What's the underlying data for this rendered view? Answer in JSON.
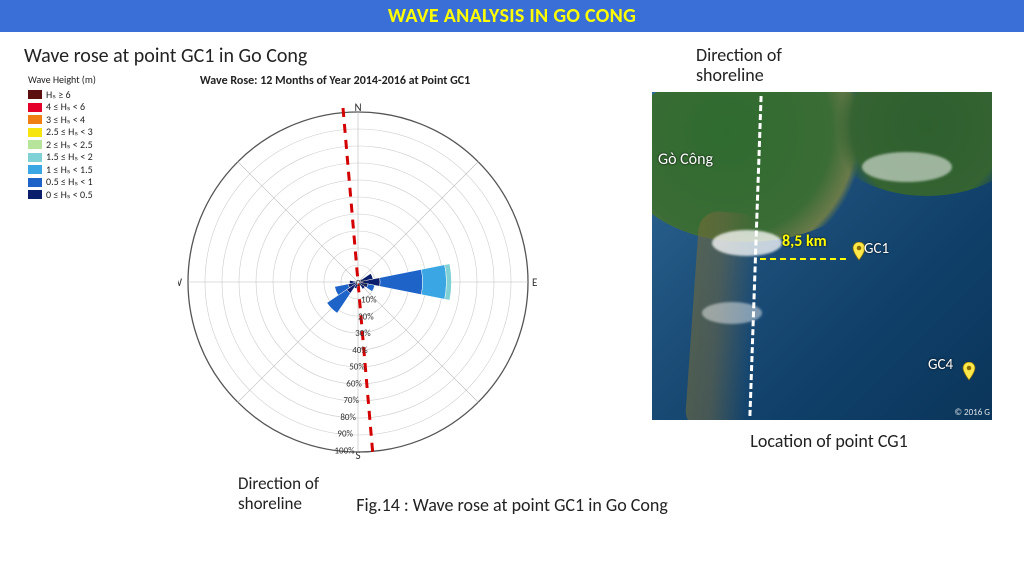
{
  "header": {
    "title": "WAVE ANALYSIS IN GO CONG"
  },
  "left": {
    "caption": "Wave rose at point GC1 in Go Cong",
    "chart_title": "Wave Rose: 12 Months of Year 2014-2016 at Point GC1",
    "legend_title": "Wave Height (m)",
    "legend": [
      {
        "label": "Hₛ ≥ 6",
        "color": "#5b0f0f"
      },
      {
        "label": "4 ≤ Hₛ < 6",
        "color": "#e4002b"
      },
      {
        "label": "3 ≤ Hₛ < 4",
        "color": "#f07f13"
      },
      {
        "label": "2.5 ≤ Hₛ < 3",
        "color": "#f6e50e"
      },
      {
        "label": "2 ≤ Hₛ < 2.5",
        "color": "#b7e49b"
      },
      {
        "label": "1.5 ≤ Hₛ < 2",
        "color": "#7fd1d6"
      },
      {
        "label": "1 ≤ Hₛ < 1.5",
        "color": "#3aa7e4"
      },
      {
        "label": "0.5 ≤ Hₛ < 1",
        "color": "#1e63c8"
      },
      {
        "label": "0 ≤ Hₛ < 0.5",
        "color": "#0a1e6b"
      }
    ],
    "compass": {
      "N": "N",
      "E": "E",
      "S": "S",
      "W": "W"
    },
    "rings_pct": [
      "0%",
      "10%",
      "20%",
      "30%",
      "40%",
      "50%",
      "60%",
      "70%",
      "80%",
      "90%",
      "100%"
    ],
    "shoreline_label": "Direction of shoreline"
  },
  "right": {
    "direction_label": "Direction of shoreline",
    "place_label": "Gò Công",
    "distance_label": "8,5 km",
    "points": {
      "gc1": "GC1",
      "gc4": "GC4"
    },
    "copyright": "© 2016 G",
    "map_caption": "Location of point CG1"
  },
  "figure_caption": "Fig.14 : Wave rose at point GC1 in Go Cong",
  "chart_data": {
    "type": "wave_rose",
    "title": "Wave Rose: 12 Months of Year 2014-2016 at Point GC1",
    "radial_unit": "percent_frequency",
    "radial_ticks_pct": [
      0,
      10,
      20,
      30,
      40,
      50,
      60,
      70,
      80,
      90,
      100
    ],
    "direction_bins_deg": 22.5,
    "height_bins_m": [
      0,
      0.5,
      1,
      1.5,
      2,
      2.5,
      3,
      4,
      6
    ],
    "colors": [
      "#0a1e6b",
      "#1e63c8",
      "#3aa7e4",
      "#7fd1d6",
      "#b7e49b",
      "#f6e50e",
      "#f07f13",
      "#e4002b",
      "#5b0f0f"
    ],
    "sectors": [
      {
        "dir_center_deg": 90,
        "compass": "E",
        "stack_pct": [
          13,
          25,
          14,
          3
        ]
      },
      {
        "dir_center_deg": 67.5,
        "compass": "ENE",
        "stack_pct": [
          9
        ]
      },
      {
        "dir_center_deg": 112.5,
        "compass": "ESE",
        "stack_pct": [
          6,
          4
        ]
      },
      {
        "dir_center_deg": 135,
        "compass": "SE",
        "stack_pct": [
          5
        ]
      },
      {
        "dir_center_deg": 225,
        "compass": "SW",
        "stack_pct": [
          8,
          14
        ]
      },
      {
        "dir_center_deg": 247.5,
        "compass": "WSW",
        "stack_pct": [
          6,
          8
        ]
      },
      {
        "dir_center_deg": 202.5,
        "compass": "SSW",
        "stack_pct": [
          4
        ]
      },
      {
        "dir_center_deg": 270,
        "compass": "W",
        "stack_pct": [
          5
        ]
      }
    ],
    "shoreline_azimuth_deg": 5
  }
}
